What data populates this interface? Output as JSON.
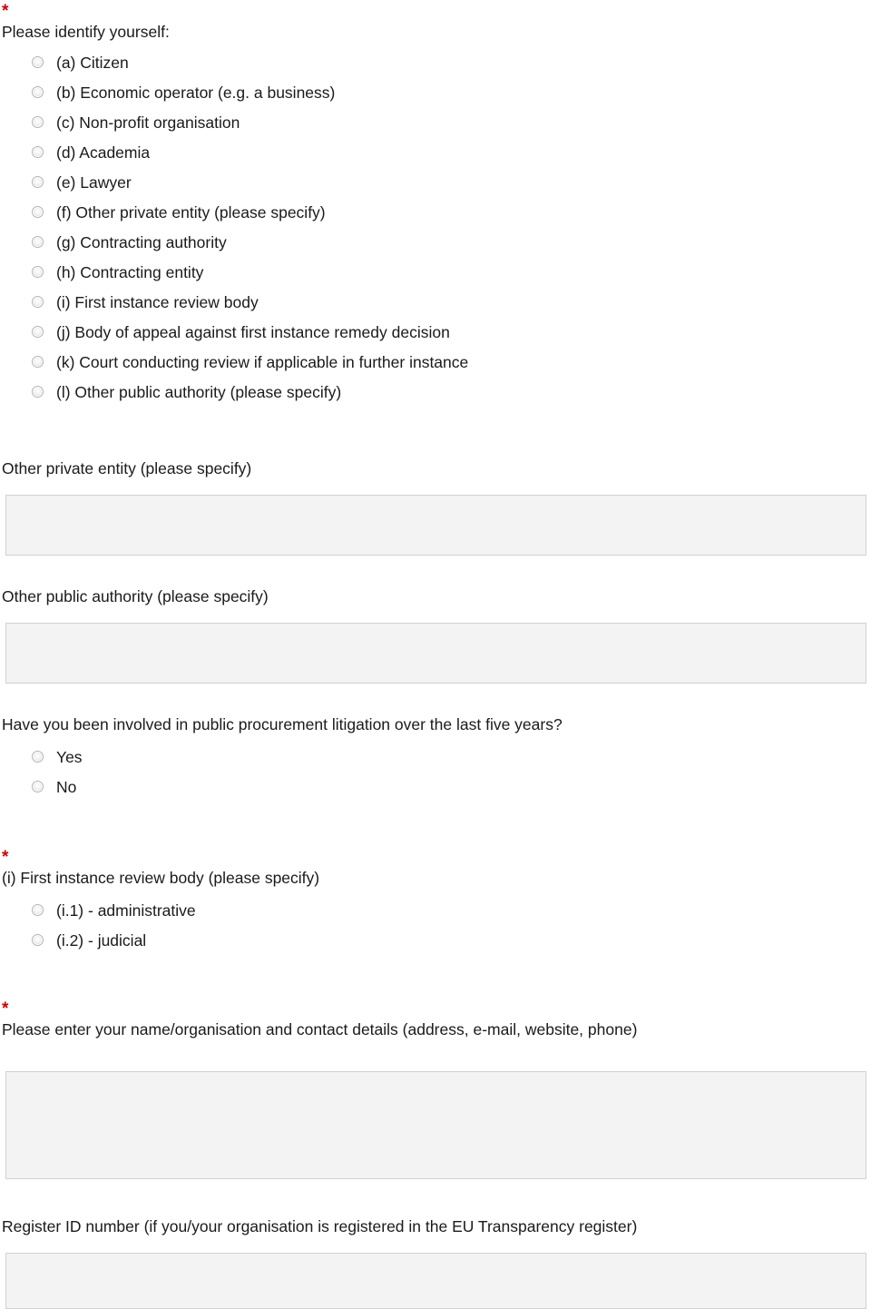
{
  "form": {
    "identify": {
      "required_marker": "*",
      "question": "Please identify yourself:",
      "options": [
        "(a) Citizen",
        "(b) Economic operator (e.g. a business)",
        "(c) Non-profit organisation",
        "(d) Academia",
        "(e) Lawyer",
        "(f) Other private entity (please specify)",
        "(g) Contracting authority",
        "(h) Contracting entity",
        "(i) First instance review body",
        "(j) Body of appeal against first instance remedy decision",
        "(k) Court conducting review if applicable in further instance",
        "(l) Other public authority (please specify)"
      ]
    },
    "other_private_entity": {
      "label": "Other private entity (please specify)",
      "value": "",
      "placeholder": ""
    },
    "other_public_authority": {
      "label": "Other public authority (please specify)",
      "value": "",
      "placeholder": ""
    },
    "litigation": {
      "question": "Have you been involved in public procurement litigation over the last five years?",
      "options": [
        "Yes",
        "No"
      ]
    },
    "first_instance": {
      "required_marker": "*",
      "question": "(i) First instance review body (please specify)",
      "options": [
        "(i.1) - administrative",
        "(i.2) - judicial"
      ]
    },
    "contact": {
      "required_marker": "*",
      "label": "Please enter your name/organisation and contact details (address, e-mail, website, phone)",
      "value": "",
      "placeholder": ""
    },
    "register_id": {
      "label": "Register ID number (if you/your organisation is registered in the EU Transparency register)",
      "value": "",
      "placeholder": ""
    }
  },
  "colors": {
    "required": "#cc0000",
    "text": "#1a1a1a",
    "field_bg": "#f3f3f3",
    "field_border": "#d2d2d2"
  }
}
